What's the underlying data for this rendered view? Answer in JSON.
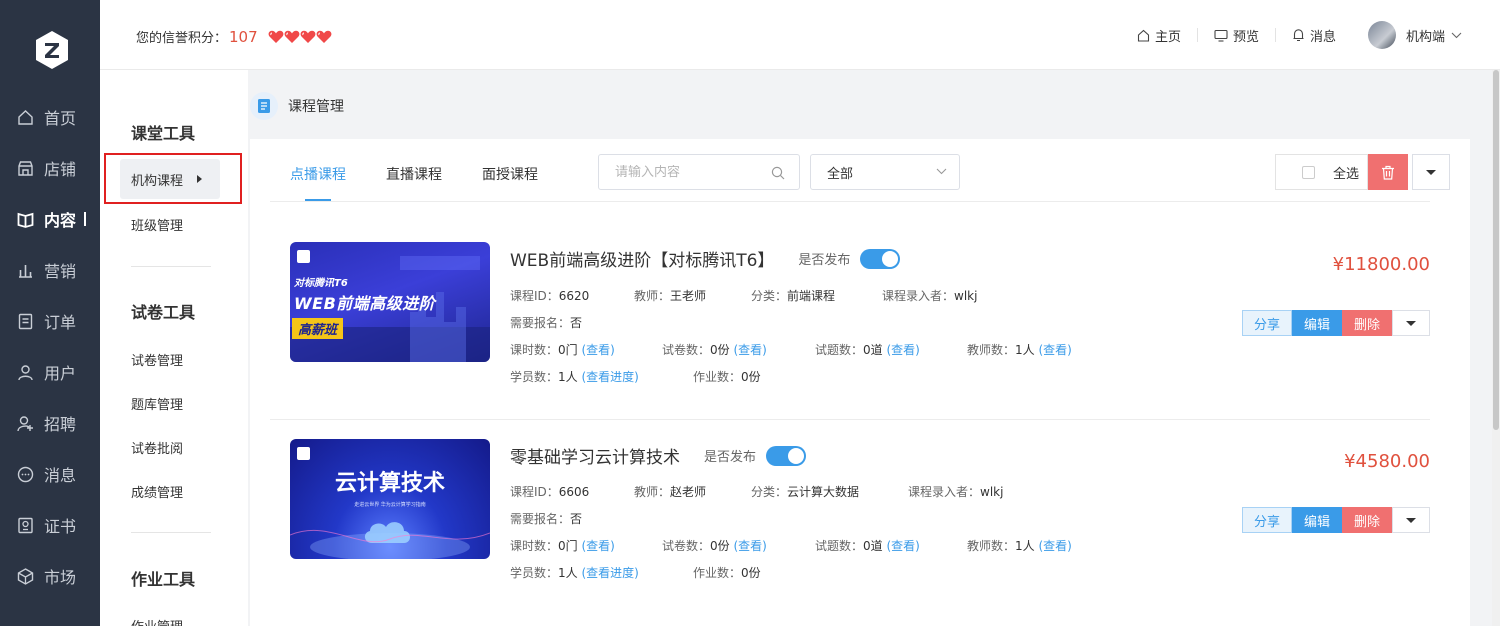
{
  "nav": {
    "items": [
      {
        "label": "首页",
        "icon": "home-icon"
      },
      {
        "label": "店铺",
        "icon": "store-icon"
      },
      {
        "label": "内容",
        "icon": "book-icon",
        "active": true
      },
      {
        "label": "营销",
        "icon": "chart-icon"
      },
      {
        "label": "订单",
        "icon": "order-icon"
      },
      {
        "label": "用户",
        "icon": "user-icon"
      },
      {
        "label": "招聘",
        "icon": "recruit-icon"
      },
      {
        "label": "消息",
        "icon": "message-icon"
      },
      {
        "label": "证书",
        "icon": "certificate-icon"
      },
      {
        "label": "市场",
        "icon": "market-icon"
      }
    ]
  },
  "header": {
    "credit_label": "您的信誉积分：",
    "credit_value": "107",
    "hearts": 4,
    "links": [
      {
        "label": "主页",
        "icon": "home-icon"
      },
      {
        "label": "预览",
        "icon": "monitor-icon"
      },
      {
        "label": "消息",
        "icon": "bell-icon"
      }
    ],
    "user_name": "机构端"
  },
  "sidebar": {
    "section1_title": "课堂工具",
    "active_item": "机构课程",
    "item_class": "班级管理",
    "section2_title": "试卷工具",
    "items2": [
      "试卷管理",
      "题库管理",
      "试卷批阅",
      "成绩管理"
    ],
    "section3_title": "作业工具",
    "item_hw": "作业管理"
  },
  "page": {
    "title": "课程管理"
  },
  "toolbar": {
    "tabs": [
      "点播课程",
      "直播课程",
      "面授课程"
    ],
    "search_placeholder": "请输入内容",
    "select_value": "全部",
    "select_all": "全选"
  },
  "courses": [
    {
      "title": "WEB前端高级进阶【对标腾讯T6】",
      "published_label": "是否发布",
      "id_label": "课程ID：",
      "id": "6620",
      "teacher_label": "教师：",
      "teacher": "王老师",
      "category_label": "分类：",
      "category": "前端课程",
      "recorder_label": "课程录入者：",
      "recorder": "wlkj",
      "signup_label": "需要报名：",
      "signup": "否",
      "lessons_label": "课时数：",
      "lessons": "0门",
      "papers_label": "试卷数：",
      "papers": "0份",
      "questions_label": "试题数：",
      "questions": "0道",
      "teachers_label": "教师数：",
      "teachers": "1人",
      "view": "(查看)",
      "students_label": "学员数：",
      "students": "1人",
      "progress": "(查看进度)",
      "homework_label": "作业数：",
      "homework": "0份",
      "price": "¥11800.00",
      "thumb": {
        "line1": "对标腾讯T6",
        "line2": "WEB前端高级进阶",
        "badge": "高薪班"
      }
    },
    {
      "title": "零基础学习云计算技术",
      "published_label": "是否发布",
      "id_label": "课程ID：",
      "id": "6606",
      "teacher_label": "教师：",
      "teacher": "赵老师",
      "category_label": "分类：",
      "category": "云计算大数据",
      "recorder_label": "课程录入者：",
      "recorder": "wlkj",
      "signup_label": "需要报名：",
      "signup": "否",
      "lessons_label": "课时数：",
      "lessons": "0门",
      "papers_label": "试卷数：",
      "papers": "0份",
      "questions_label": "试题数：",
      "questions": "0道",
      "teachers_label": "教师数：",
      "teachers": "1人",
      "view": "(查看)",
      "students_label": "学员数：",
      "students": "1人",
      "progress": "(查看进度)",
      "homework_label": "作业数：",
      "homework": "0份",
      "price": "¥4580.00",
      "thumb": {
        "line1": "云计算技术",
        "line2": "走进云世界 华为云计算学习指南"
      }
    }
  ],
  "actions": {
    "share": "分享",
    "edit": "编辑",
    "delete": "删除"
  },
  "colors": {
    "accent": "#3a9be8",
    "danger": "#f07070",
    "price": "#e0513e",
    "nav_bg": "#2b3444"
  }
}
